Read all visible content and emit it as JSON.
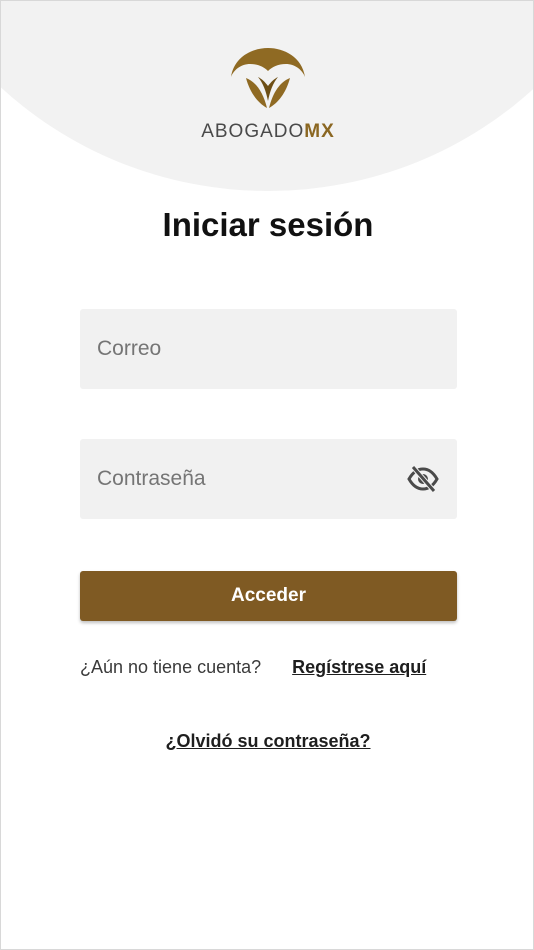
{
  "brand": {
    "name_main": "ABOGADO",
    "name_accent": "MX",
    "logo_icon": "shield-leaf-icon",
    "accent_color": "#8b6722"
  },
  "page": {
    "title": "Iniciar sesión"
  },
  "form": {
    "email_placeholder": "Correo",
    "password_placeholder": "Contraseña",
    "password_toggle_icon": "eye-off-icon",
    "submit_label": "Acceder",
    "button_color": "#7f5a23"
  },
  "links": {
    "no_account_text": "¿Aún no tiene cuenta?",
    "register_label": "Regístrese aquí",
    "forgot_label": "¿Olvidó su contraseña?"
  }
}
